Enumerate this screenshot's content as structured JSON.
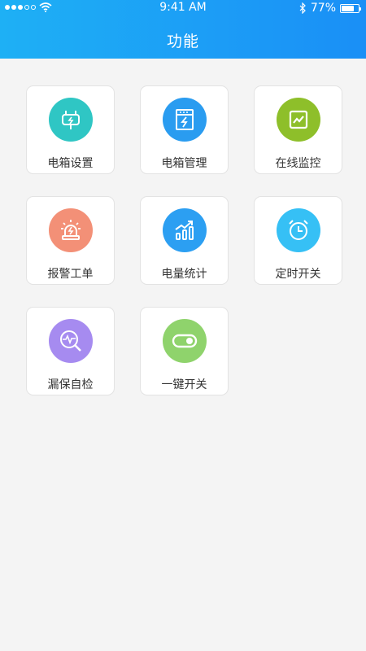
{
  "status_bar": {
    "time": "9:41 AM",
    "battery_percent": "77%",
    "battery_level": 0.77,
    "signal_dots_filled": 3,
    "signal_dots_total": 5,
    "icons": [
      "signal-dots-icon",
      "wifi-icon",
      "bluetooth-icon",
      "battery-icon"
    ]
  },
  "header": {
    "title": "功能"
  },
  "functions": [
    {
      "label": "电箱设置",
      "icon": "plug-icon",
      "color": "#2fc6c4"
    },
    {
      "label": "电箱管理",
      "icon": "electric-box-icon",
      "color": "#2a9cf0"
    },
    {
      "label": "在线监控",
      "icon": "monitor-chart-icon",
      "color": "#8ebf2a"
    },
    {
      "label": "报警工单",
      "icon": "alarm-light-icon",
      "color": "#f39077"
    },
    {
      "label": "电量统计",
      "icon": "bar-chart-icon",
      "color": "#2c9ff2"
    },
    {
      "label": "定时开关",
      "icon": "alarm-clock-icon",
      "color": "#36c0f5"
    },
    {
      "label": "漏保自检",
      "icon": "leak-detect-icon",
      "color": "#a68bf0"
    },
    {
      "label": "一键开关",
      "icon": "toggle-switch-icon",
      "color": "#8fd36c"
    }
  ]
}
